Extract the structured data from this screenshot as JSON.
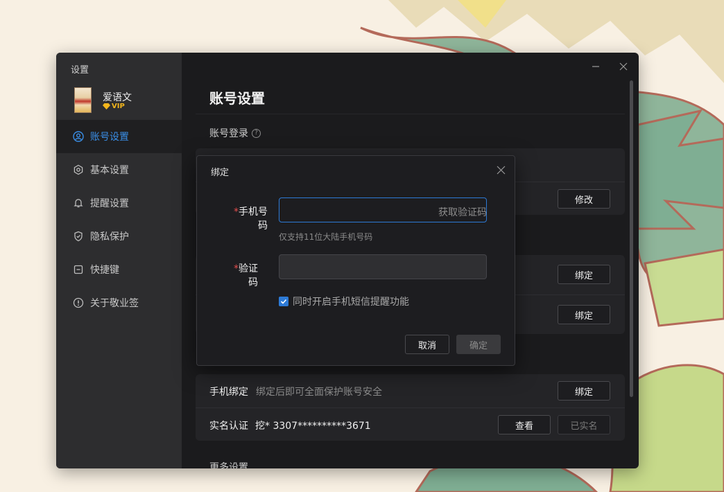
{
  "window": {
    "title": "设置",
    "user": {
      "name": "爱语文",
      "badge": "VIP"
    },
    "nav": [
      {
        "label": "账号设置",
        "icon": "user-circle-icon",
        "active": true
      },
      {
        "label": "基本设置",
        "icon": "gear-icon",
        "active": false
      },
      {
        "label": "提醒设置",
        "icon": "bell-icon",
        "active": false
      },
      {
        "label": "隐私保护",
        "icon": "shield-icon",
        "active": false
      },
      {
        "label": "快捷键",
        "icon": "keyboard-icon",
        "active": false
      },
      {
        "label": "关于敬业签",
        "icon": "info-icon",
        "active": false
      }
    ],
    "controls": {
      "minimize_icon": "minimize-icon",
      "close_icon": "close-icon"
    }
  },
  "content": {
    "page_title": "账号设置",
    "section_login": "账号登录",
    "section_more": "更多设置",
    "buttons": {
      "modify": "修改",
      "bind_1": "绑定",
      "bind_2": "绑定"
    },
    "phone_row": {
      "label": "手机绑定",
      "desc": "绑定后即可全面保护账号安全",
      "button": "绑定"
    },
    "realname_row": {
      "label": "实名认证",
      "value": "挖* 3307**********3671",
      "view_button": "查看",
      "status_button": "已实名"
    }
  },
  "modal": {
    "title": "绑定",
    "phone_label": "手机号码",
    "phone_value": "",
    "phone_placeholder": "",
    "get_code": "获取验证码",
    "phone_hint": "仅支持11位大陆手机号码",
    "code_label": "验证码",
    "code_value": "",
    "checkbox_label": "同时开启手机短信提醒功能",
    "checkbox_checked": true,
    "cancel": "取消",
    "confirm": "确定",
    "required_mark": "*"
  },
  "colors": {
    "accent": "#2d7ad6",
    "active_nav": "#3a8ee6",
    "vip": "#f2b51c",
    "required": "#e34d4d"
  }
}
